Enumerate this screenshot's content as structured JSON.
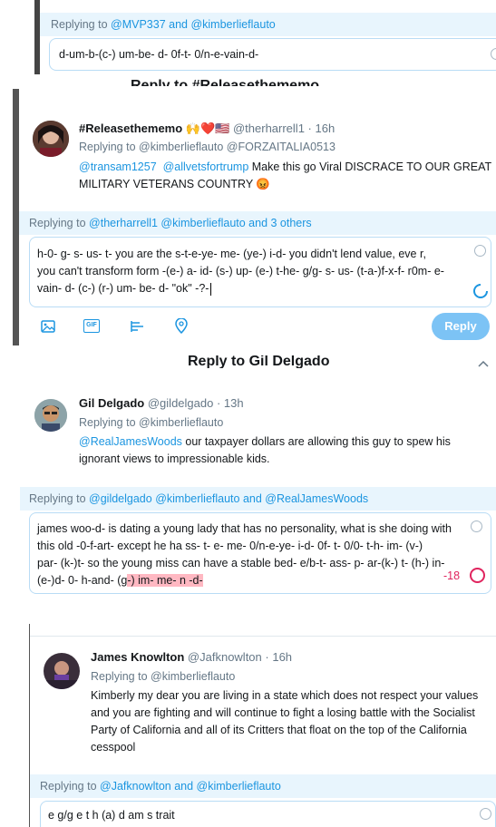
{
  "section1": {
    "replying_prefix": "Replying to",
    "mentions": "@MVP337 and @kimberlieflauto",
    "draft": "d-um-b-(c-) um-be- d- 0f-t- 0/n-e-vain-d-"
  },
  "section2": {
    "header_title": "Reply to #Releasethememo",
    "tweet": {
      "name": "#Releasethememo 🙌❤️🇺🇸",
      "handle": "@therharrell1",
      "time": "· 16h",
      "replying_prefix": "Replying to",
      "replying_to": "@kimberlieflauto @FORZAITALIA0513",
      "mention1": "@transam1257",
      "mention2": "@allvetsfortrump",
      "text_line1": " Make this go Viral DISCRACE TO OUR GREAT",
      "text_line2": "MILITARY VETERANS COUNTRY 😡"
    },
    "reply_bar_prefix": "Replying to",
    "reply_bar_mentions": "@therharrell1 @kimberlieflauto and 3 others",
    "draft_line1": "h-0- g- s- us- t-  you are the s-t-e-ye- me- (ye-) i-d-  you didn't lend value, eve r,",
    "draft_line2": "you can't transform form -(e-) a- id- (s-) up- (e-) t-he- g/g- s- us- (t-a-)f-x-f- r0m- e-",
    "draft_line3": "vain- d- (c-) (r-) um- be- d-   \"ok\" -?-",
    "gif_label": "GIF",
    "reply_button": "Reply"
  },
  "section3": {
    "header_title": "Reply to Gil Delgado",
    "tweet": {
      "name": "Gil Delgado",
      "handle": "@gildelgado",
      "time": "· 13h",
      "replying_prefix": "Replying to",
      "replying_to": "@kimberlieflauto",
      "mention": "@RealJamesWoods",
      "text_line1": " our taxpayer dollars are allowing this guy to spew his",
      "text_line2": "ignorant views to impressionable kids."
    },
    "reply_bar_prefix": "Replying to",
    "reply_bar_mentions": "@gildelgado @kimberlieflauto and @RealJamesWoods",
    "draft_line1": "james woo-d- is dating a young lady that has no personality, what is she doing with",
    "draft_line2": "this old -0-f-art-   except he ha ss- t- e- me- 0/n-e-ye- i-d- 0f- t- 0/0- t-h- im- (v-)",
    "draft_line3": "par- (k-)t-   so the young miss can have a stable bed- e/b-t- ass- p- ar-(k-) t- (h-) in-",
    "draft_line4a": "(e-)d- 0- h-and- (g",
    "draft_line4b": "-) im- me- n -d-",
    "char_count": "-18"
  },
  "section4": {
    "tweet": {
      "name": "James Knowlton",
      "handle": "@Jafknowlton",
      "time": "· 16h",
      "replying_prefix": "Replying to",
      "replying_to": "@kimberlieflauto",
      "text_line1": "Kimberly my dear you are living in a state which does not respect your values",
      "text_line2": "and you are fighting and will continue to fight a losing battle with the Socialist",
      "text_line3": "Party of California and all of its Critters that float on the top of the California",
      "text_line4": "cesspool"
    },
    "reply_bar_prefix": "Replying to",
    "reply_bar_mentions": "@Jafknowlton and @kimberlieflauto",
    "draft": "e g/g e t h (a) d am s trait"
  },
  "colors": {
    "accent": "#1b95e0",
    "reply_bar": "#e8f5fd",
    "button": "#7cc3f5",
    "over_limit": "#e0245e",
    "highlight": "#ffb8c2"
  }
}
